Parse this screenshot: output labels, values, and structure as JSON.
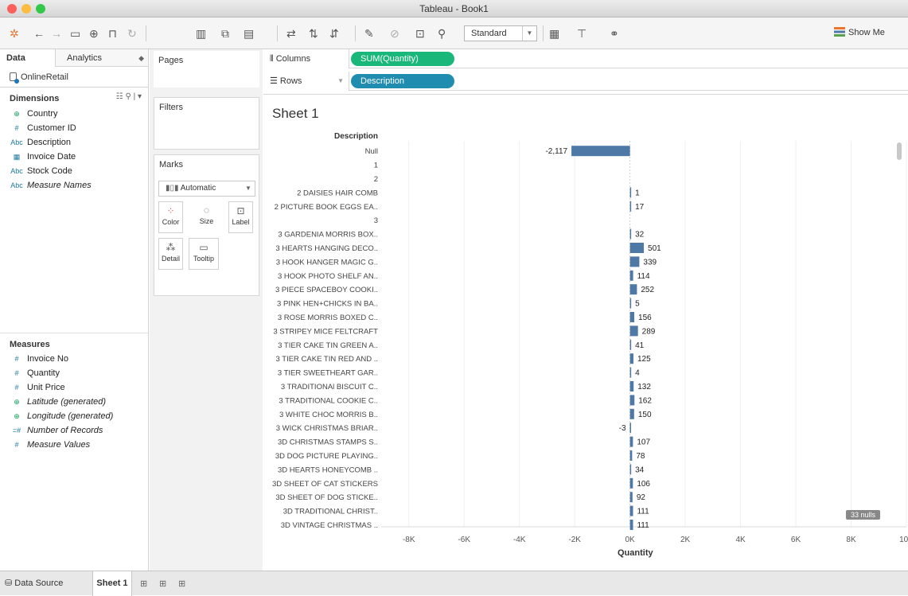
{
  "window": {
    "title": "Tableau - Book1"
  },
  "toolbar": {
    "mode_select": "Standard",
    "show_me": "Show Me"
  },
  "left_pane": {
    "tab_data": "Data",
    "tab_analytics": "Analytics",
    "datasource": "OnlineRetail",
    "dimensions_header": "Dimensions",
    "dimensions": [
      {
        "type": "globe",
        "type_glyph": "⊕",
        "label": "Country"
      },
      {
        "type": "number",
        "type_glyph": "#",
        "label": "Customer ID"
      },
      {
        "type": "string",
        "type_glyph": "Abc",
        "label": "Description"
      },
      {
        "type": "date",
        "type_glyph": "▦",
        "label": "Invoice Date"
      },
      {
        "type": "string",
        "type_glyph": "Abc",
        "label": "Stock Code"
      },
      {
        "type": "string",
        "type_glyph": "Abc",
        "label": "Measure Names"
      }
    ],
    "measures_header": "Measures",
    "measures": [
      {
        "type": "number",
        "type_glyph": "#",
        "label": "Invoice No"
      },
      {
        "type": "number",
        "type_glyph": "#",
        "label": "Quantity"
      },
      {
        "type": "number",
        "type_glyph": "#",
        "label": "Unit Price"
      },
      {
        "type": "globe",
        "type_glyph": "⊕",
        "label": "Latitude (generated)"
      },
      {
        "type": "globe",
        "type_glyph": "⊕",
        "label": "Longitude (generated)"
      },
      {
        "type": "number",
        "type_glyph": "=#",
        "label": "Number of Records"
      },
      {
        "type": "number",
        "type_glyph": "#",
        "label": "Measure Values"
      }
    ]
  },
  "cards": {
    "pages": "Pages",
    "filters": "Filters",
    "marks": "Marks",
    "marks_type": "Automatic",
    "color": "Color",
    "size": "Size",
    "label": "Label",
    "detail": "Detail",
    "tooltip": "Tooltip"
  },
  "shelves": {
    "columns_label": "Columns",
    "columns_pill": "SUM(Quantity)",
    "columns_pill_color": "#1ab77a",
    "rows_label": "Rows",
    "rows_pill": "Description",
    "rows_pill_color": "#1f8cb0"
  },
  "view": {
    "sheet_title": "Sheet 1",
    "row_header_title": "Description",
    "nulls_badge": "33 nulls"
  },
  "chart_data": {
    "type": "bar",
    "orientation": "horizontal",
    "xlabel": "Quantity",
    "xlim": [
      -9000,
      10000
    ],
    "x_ticks": [
      "-8K",
      "-6K",
      "-4K",
      "-2K",
      "0K",
      "2K",
      "4K",
      "6K",
      "8K",
      "10K"
    ],
    "x_tick_values": [
      -8000,
      -6000,
      -4000,
      -2000,
      0,
      2000,
      4000,
      6000,
      8000,
      10000
    ],
    "bar_color": "#4e79a7",
    "categories": [
      "Null",
      "1",
      "2",
      "2 DAISIES HAIR COMB",
      "2 PICTURE BOOK EGGS EA..",
      "3",
      "3 GARDENIA MORRIS BOX..",
      "3 HEARTS HANGING DECO..",
      "3 HOOK HANGER MAGIC G..",
      "3 HOOK PHOTO SHELF AN..",
      "3 PIECE SPACEBOY COOKI..",
      "3 PINK HEN+CHICKS IN BA..",
      "3 ROSE MORRIS BOXED C..",
      "3 STRIPEY MICE FELTCRAFT",
      "3 TIER CAKE TIN GREEN A..",
      "3 TIER CAKE TIN RED AND ..",
      "3 TIER SWEETHEART GAR..",
      "3 TRADITIONAl BISCUIT C..",
      "3 TRADITIONAL COOKIE C..",
      "3 WHITE CHOC MORRIS B..",
      "3 WICK CHRISTMAS BRIAR..",
      "3D CHRISTMAS STAMPS S..",
      "3D DOG PICTURE PLAYING..",
      "3D HEARTS  HONEYCOMB ..",
      "3D SHEET OF CAT STICKERS",
      "3D SHEET OF DOG STICKE..",
      "3D TRADITIONAL CHRIST..",
      "3D VINTAGE CHRISTMAS .."
    ],
    "values": [
      -2117,
      null,
      null,
      1,
      17,
      null,
      32,
      501,
      339,
      114,
      252,
      5,
      156,
      289,
      41,
      125,
      4,
      132,
      162,
      150,
      -3,
      107,
      78,
      34,
      106,
      92,
      111,
      111
    ],
    "labels": [
      "-2,117",
      "",
      "",
      "1",
      "17",
      "",
      "32",
      "501",
      "339",
      "114",
      "252",
      "5",
      "156",
      "289",
      "41",
      "125",
      "4",
      "132",
      "162",
      "150",
      "-3",
      "107",
      "78",
      "34",
      "106",
      "92",
      "111",
      "111"
    ]
  },
  "bottom": {
    "data_source_tab": "Data Source",
    "sheet_tab": "Sheet 1"
  }
}
